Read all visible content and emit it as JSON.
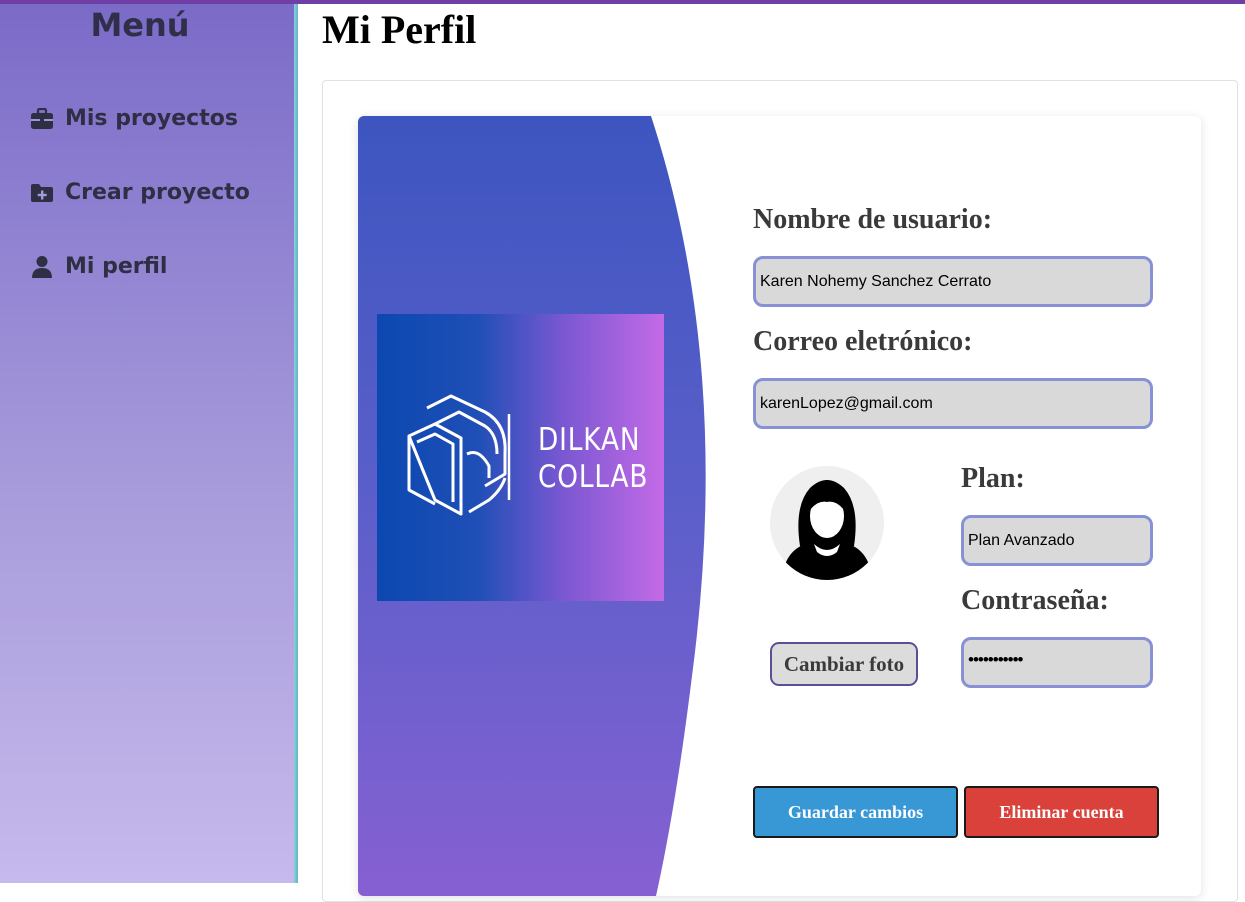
{
  "sidebar": {
    "title": "Menú",
    "items": [
      {
        "label": "Mis proyectos",
        "icon": "briefcase-icon"
      },
      {
        "label": "Crear proyecto",
        "icon": "folder-plus-icon"
      },
      {
        "label": "Mi perfil",
        "icon": "user-icon"
      }
    ]
  },
  "page": {
    "title": "Mi Perfil"
  },
  "brand": {
    "line1": "DILKAN",
    "line2": "COLLAB"
  },
  "form": {
    "username_label": "Nombre de usuario:",
    "username_value": "Karen Nohemy Sanchez Cerrato",
    "email_label": "Correo eletrónico:",
    "email_value": "karenLopez@gmail.com",
    "plan_label": "Plan:",
    "plan_value": "Plan Avanzado",
    "password_label": "Contraseña:",
    "password_value": "•••••••••••"
  },
  "buttons": {
    "change_photo": "Cambiar foto",
    "save": "Guardar cambios",
    "delete": "Eliminar cuenta"
  },
  "colors": {
    "accent": "#6f3fa6",
    "save": "#3898d6",
    "delete": "#d9413a",
    "field_border": "#8890d6"
  }
}
